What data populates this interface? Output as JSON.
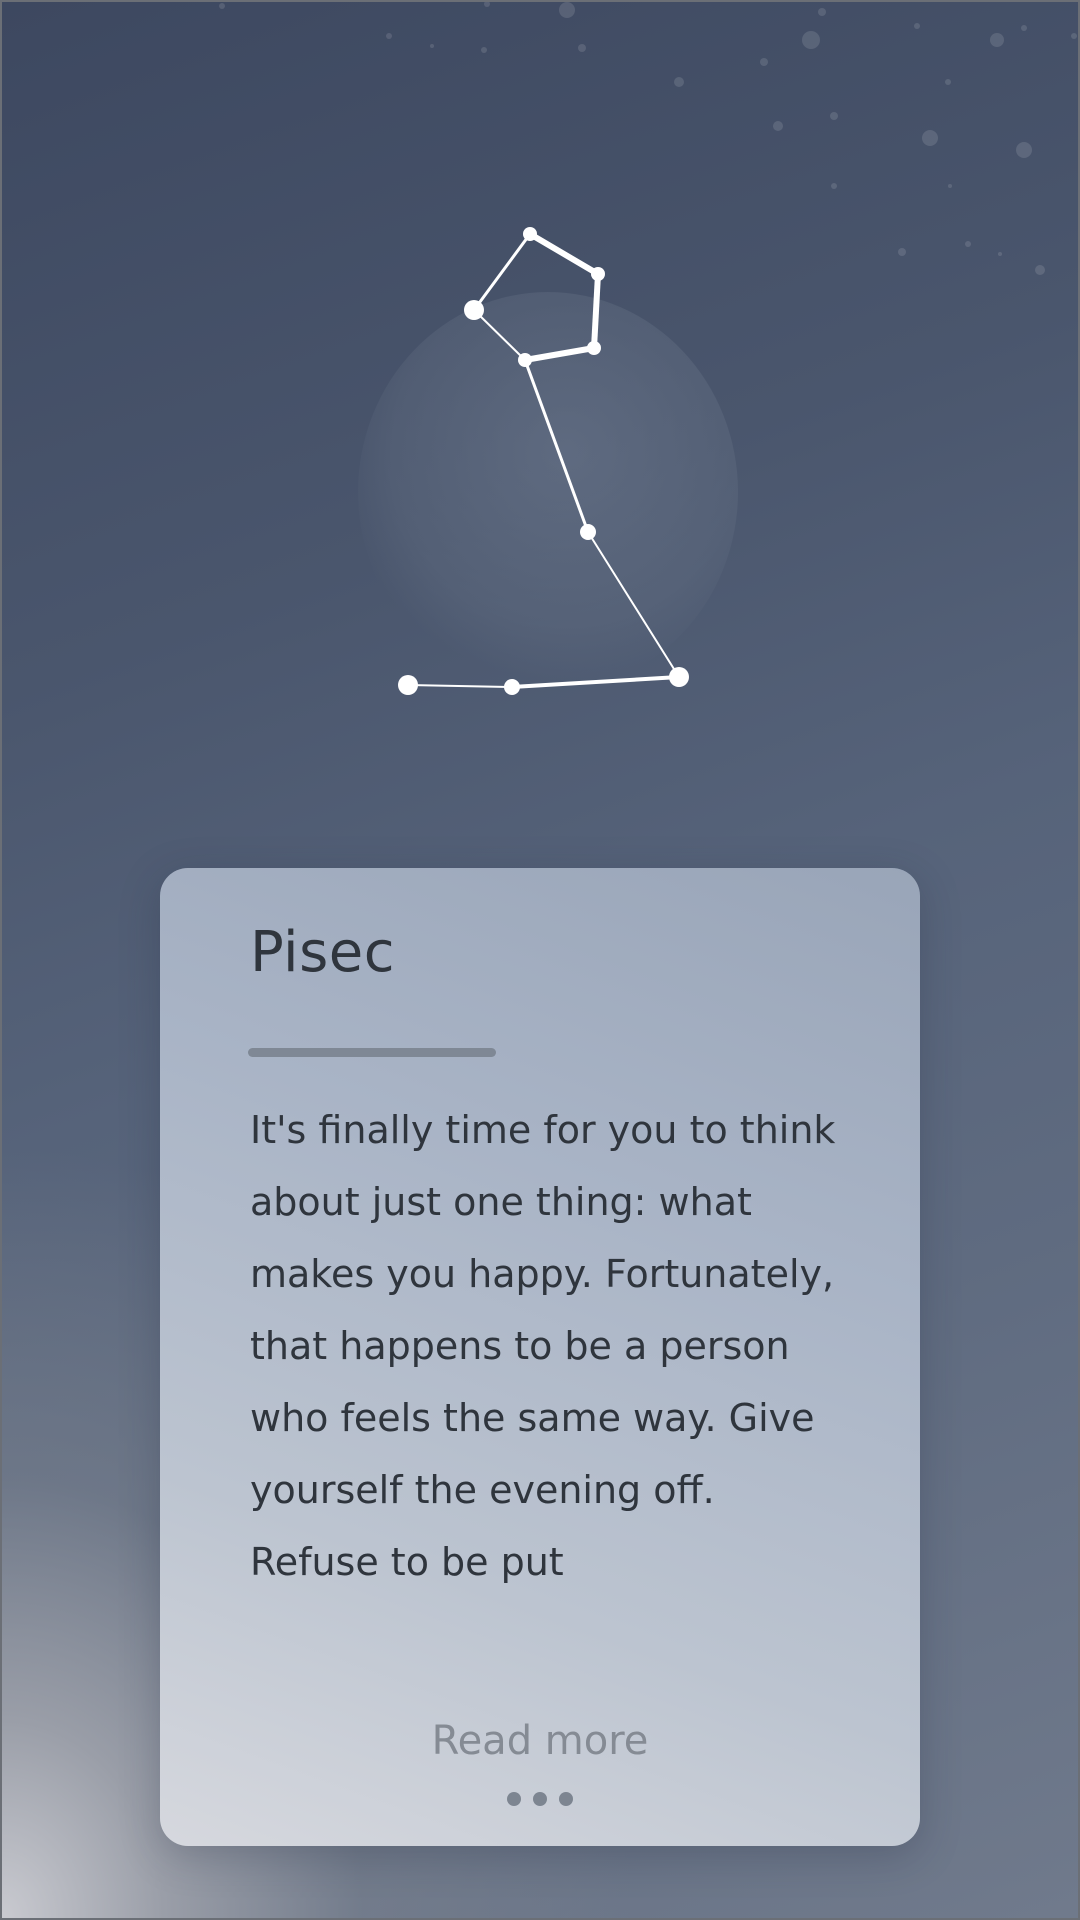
{
  "sign": {
    "title": "Pisec",
    "horoscope": "It's finally time for you to think about just one thing: what makes you happy. Fortunately, that happens to be a person who feels the same way. Give yourself the evening off. Refuse to be put",
    "read_more_label": "Read more",
    "pager_dots": 3
  },
  "constellation_icon": "pisces-constellation-icon",
  "colors": {
    "background_top": "#3d4860",
    "background_bottom_glow": "#c9cad0",
    "card": "#a9b4c6",
    "text": "#2f353d",
    "muted": "#858b94",
    "constellation": "#ffffff"
  }
}
